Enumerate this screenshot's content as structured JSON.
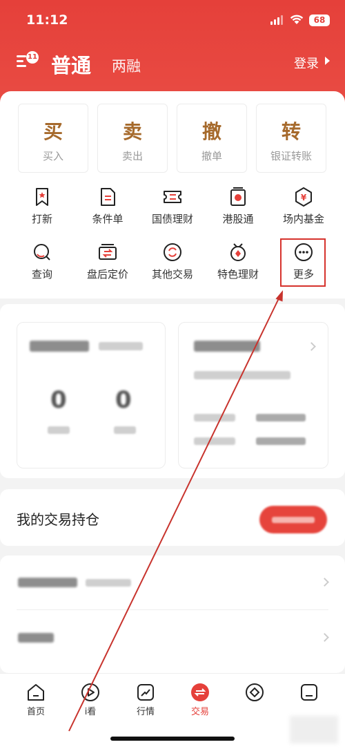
{
  "status_bar": {
    "time": "11:12",
    "battery": "68"
  },
  "nav": {
    "badge": "11",
    "tab_normal": "普通",
    "tab_margin": "两融",
    "login": "登录"
  },
  "big_actions": [
    {
      "main": "买",
      "sub": "买入"
    },
    {
      "main": "卖",
      "sub": "卖出"
    },
    {
      "main": "撤",
      "sub": "撤单"
    },
    {
      "main": "转",
      "sub": "银证转账"
    }
  ],
  "grid": [
    {
      "label": "打新",
      "icon": "ipo-icon"
    },
    {
      "label": "条件单",
      "icon": "condition-order-icon"
    },
    {
      "label": "国债理财",
      "icon": "bond-icon"
    },
    {
      "label": "港股通",
      "icon": "hk-connect-icon"
    },
    {
      "label": "场内基金",
      "icon": "fund-icon"
    },
    {
      "label": "查询",
      "icon": "query-icon"
    },
    {
      "label": "盘后定价",
      "icon": "after-hours-icon"
    },
    {
      "label": "其他交易",
      "icon": "other-trade-icon"
    },
    {
      "label": "特色理财",
      "icon": "special-finance-icon"
    },
    {
      "label": "更多",
      "icon": "more-icon"
    }
  ],
  "positions": {
    "title": "我的交易持仓"
  },
  "tabbar": [
    {
      "label": "首页",
      "icon": "home-icon"
    },
    {
      "label": "i看",
      "icon": "play-icon"
    },
    {
      "label": "行情",
      "icon": "market-icon"
    },
    {
      "label": "交易",
      "icon": "trade-icon",
      "active": true
    },
    {
      "label": "",
      "icon": "diamond-icon"
    },
    {
      "label": "",
      "icon": "account-icon"
    }
  ],
  "colors": {
    "brand": "#e5403a",
    "gold": "#a66a2c",
    "highlight_box": "#d6322c"
  }
}
